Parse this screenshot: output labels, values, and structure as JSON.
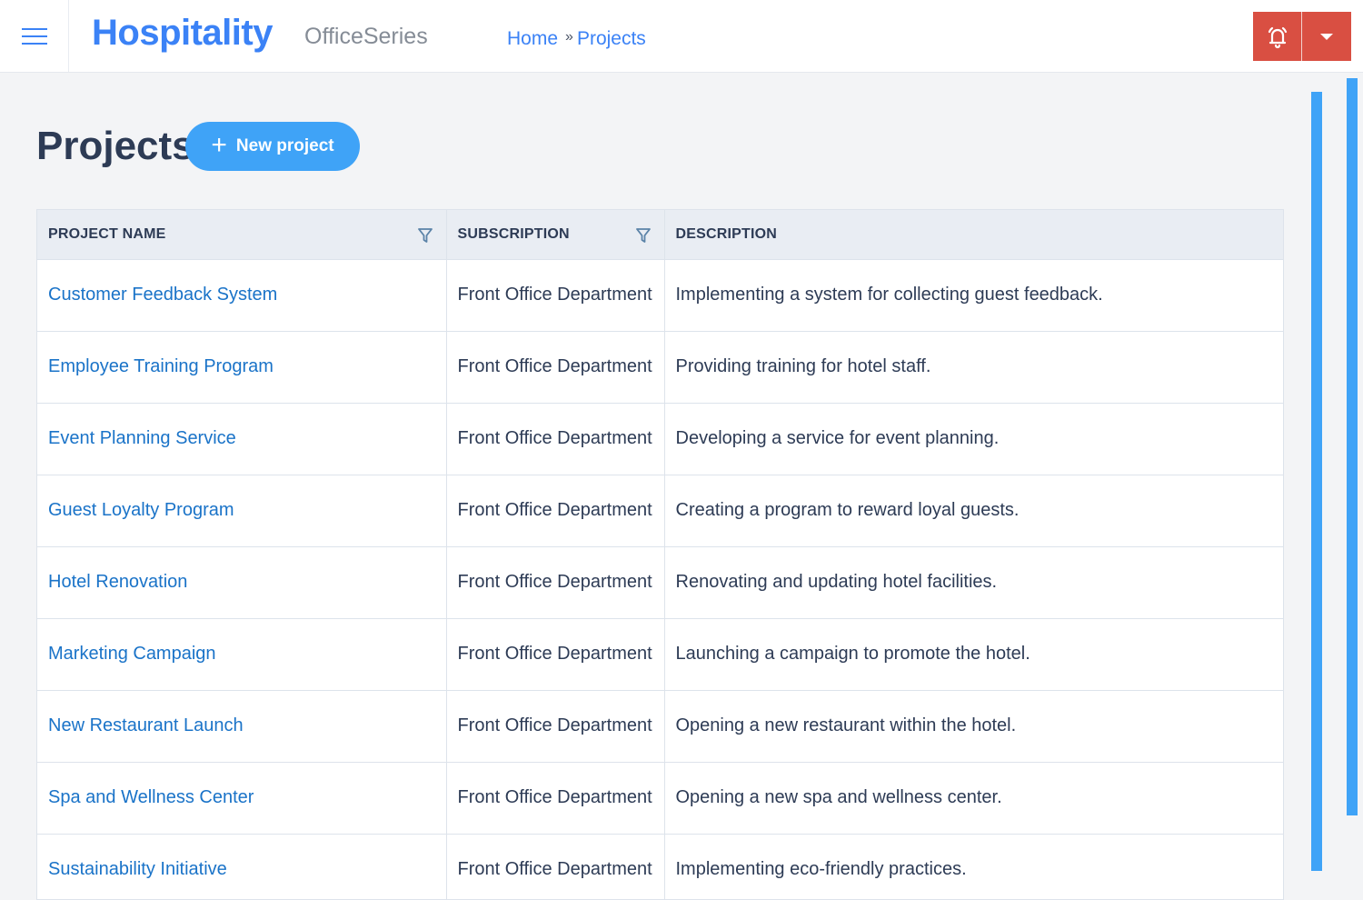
{
  "header": {
    "menu_icon": "hamburger-menu-icon",
    "brand": "Hospitality",
    "sub_brand": "OfficeSeries",
    "breadcrumb": {
      "home": "Home",
      "separator": "»",
      "current": "Projects"
    },
    "alarm_icon": "alarm-bell-icon",
    "dropdown_icon": "caret-down-icon",
    "alarm_color": "#d94f42"
  },
  "page": {
    "title": "Projects",
    "new_project_label": "New project",
    "new_project_icon": "plus-icon",
    "accent_color": "#3fa3f7"
  },
  "table": {
    "columns": [
      {
        "label": "PROJECT NAME",
        "filterable": true
      },
      {
        "label": "SUBSCRIPTION",
        "filterable": true
      },
      {
        "label": "DESCRIPTION",
        "filterable": false
      }
    ],
    "rows": [
      {
        "name": "Customer Feedback System",
        "subscription": "Front Office Department",
        "description": "Implementing a system for collecting guest feedback."
      },
      {
        "name": "Employee Training Program",
        "subscription": "Front Office Department",
        "description": "Providing training for hotel staff."
      },
      {
        "name": "Event Planning Service",
        "subscription": "Front Office Department",
        "description": "Developing a service for event planning."
      },
      {
        "name": "Guest Loyalty Program",
        "subscription": "Front Office Department",
        "description": "Creating a program to reward loyal guests."
      },
      {
        "name": "Hotel Renovation",
        "subscription": "Front Office Department",
        "description": "Renovating and updating hotel facilities."
      },
      {
        "name": "Marketing Campaign",
        "subscription": "Front Office Department",
        "description": "Launching a campaign to promote the hotel."
      },
      {
        "name": "New Restaurant Launch",
        "subscription": "Front Office Department",
        "description": "Opening a new restaurant within the hotel."
      },
      {
        "name": "Spa and Wellness Center",
        "subscription": "Front Office Department",
        "description": "Opening a new spa and wellness center."
      },
      {
        "name": "Sustainability Initiative",
        "subscription": "Front Office Department",
        "description": "Implementing eco-friendly practices."
      }
    ]
  }
}
